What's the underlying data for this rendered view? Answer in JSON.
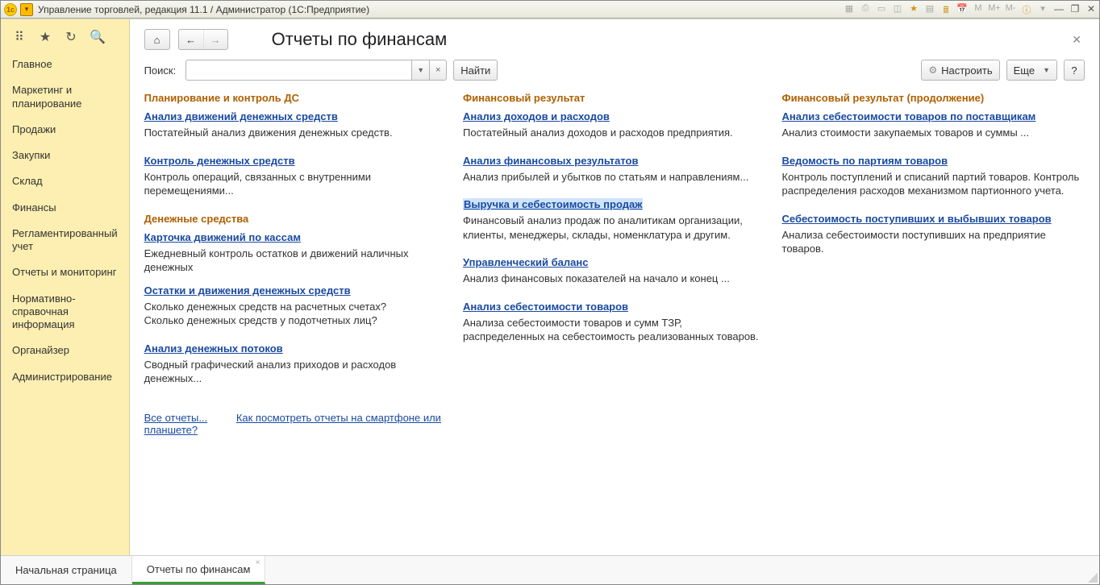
{
  "window_title": "Управление торговлей, редакция 11.1 / Администратор  (1C:Предприятие)",
  "sidebar": {
    "items": [
      "Главное",
      "Маркетинг и планирование",
      "Продажи",
      "Закупки",
      "Склад",
      "Финансы",
      "Регламентированный учет",
      "Отчеты и мониторинг",
      "Нормативно-справочная информация",
      "Органайзер",
      "Администрирование"
    ]
  },
  "header": {
    "page_title": "Отчеты по финансам",
    "search_label": "Поиск:",
    "search_value": "",
    "find_btn": "Найти",
    "configure_btn": "Настроить",
    "more_btn": "Еще",
    "help_btn": "?"
  },
  "columns": [
    {
      "sections": [
        {
          "title": "Планирование и контроль ДС",
          "reports": [
            {
              "link": "Анализ движений денежных средств",
              "desc": "Постатейный анализ движения денежных средств."
            },
            {
              "link": "Контроль денежных средств",
              "desc": "Контроль операций, связанных с внутренними перемещениями..."
            }
          ]
        },
        {
          "title": "Денежные средства",
          "reports": [
            {
              "link": "Карточка движений по кассам",
              "desc": "Ежедневный контроль остатков и движений наличных денежных"
            },
            {
              "link": "Остатки и движения денежных средств",
              "desc": "Сколько денежных средств на расчетных счетах?\nСколько денежных средств у подотчетных лиц?"
            },
            {
              "link": "Анализ денежных потоков",
              "desc": "Сводный графический анализ приходов и расходов денежных..."
            }
          ]
        }
      ]
    },
    {
      "sections": [
        {
          "title": "Финансовый результат",
          "reports": [
            {
              "link": "Анализ доходов и расходов",
              "desc": "Постатейный анализ доходов и расходов предприятия."
            },
            {
              "link": "Анализ финансовых результатов",
              "desc": "Анализ прибылей и убытков по статьям и направлениям..."
            },
            {
              "link": "Выручка и себестоимость продаж",
              "desc": "Финансовый анализ продаж по аналитикам организации, клиенты, менеджеры, склады, номенклатура и другим.",
              "highlighted": true
            },
            {
              "link": "Управленческий баланс",
              "desc": "Анализ финансовых показателей на начало и конец ..."
            },
            {
              "link": "Анализ себестоимости товаров",
              "desc": "Анализа себестоимости товаров и сумм ТЗР, распределенных на себестоимость реализованных товаров."
            }
          ]
        }
      ]
    },
    {
      "sections": [
        {
          "title": "Финансовый результат (продолжение)",
          "reports": [
            {
              "link": "Анализ себестоимости товаров по поставщикам",
              "desc": "Анализ стоимости закупаемых товаров и суммы ..."
            },
            {
              "link": "Ведомость по партиям товаров",
              "desc": "Контроль поступлений и списаний партий товаров. Контроль распределения расходов механизмом партионного учета."
            },
            {
              "link": "Себестоимость поступивших и выбывших товаров",
              "desc": "Анализа себестоимости поступивших на предприятие товаров."
            }
          ]
        }
      ]
    }
  ],
  "bottom_links": {
    "all_reports": "Все отчеты...",
    "smartphone": "Как посмотреть отчеты на смартфоне или планшете?"
  },
  "tabs": {
    "start": "Начальная страница",
    "active": "Отчеты по финансам"
  }
}
